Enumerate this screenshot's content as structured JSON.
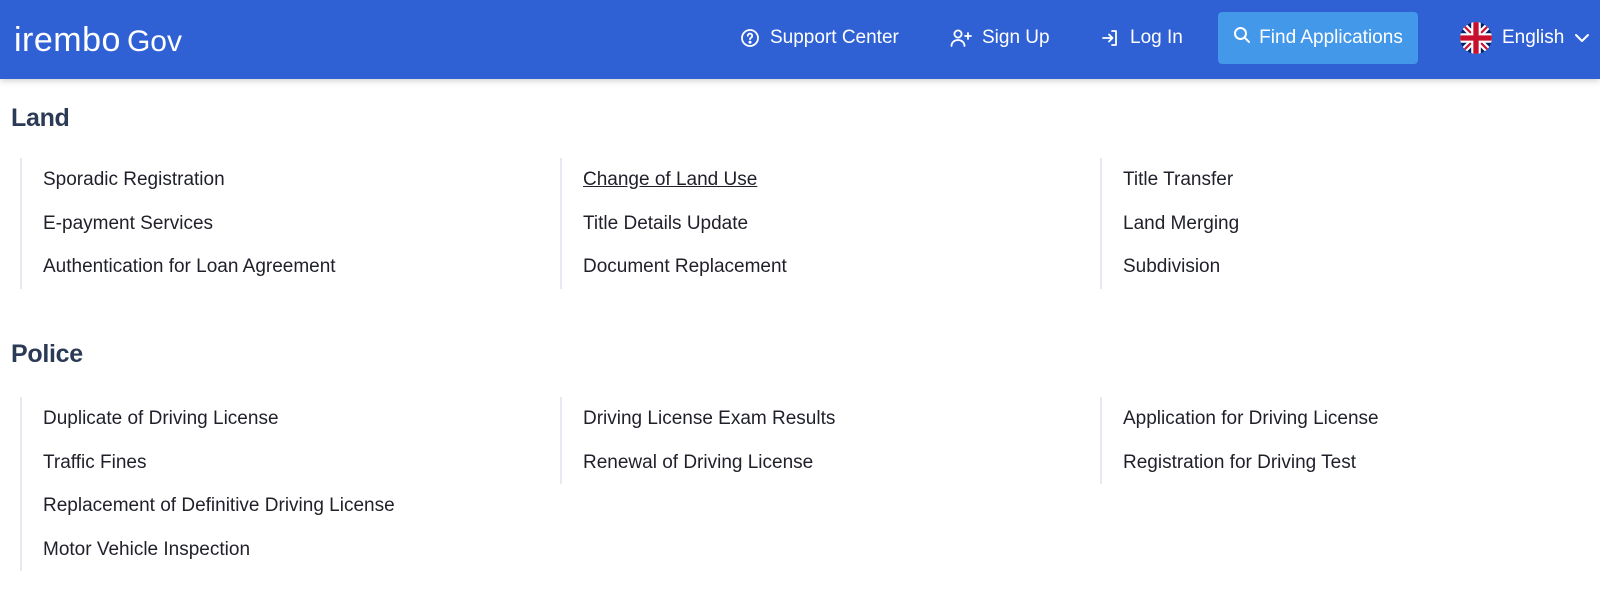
{
  "header": {
    "logo_brand": "irembo",
    "logo_suffix": "Gov",
    "support_label": "Support Center",
    "signup_label": "Sign Up",
    "login_label": "Log In",
    "find_label": "Find Applications",
    "language_label": "English",
    "icons": {
      "support": "question-circle-icon",
      "signup": "user-plus-icon",
      "login": "log-in-icon",
      "find": "search-icon",
      "language": "uk-flag-icon",
      "dropdown": "chevron-down-icon"
    },
    "colors": {
      "bar": "#2f61d5",
      "button": "#4398ea"
    }
  },
  "sections": [
    {
      "title": "Land",
      "columns": [
        [
          "Sporadic Registration",
          "E-payment Services",
          "Authentication for Loan Agreement"
        ],
        [
          "Change of Land Use",
          "Title Details Update",
          "Document Replacement"
        ],
        [
          "Title Transfer",
          "Land Merging",
          "Subdivision"
        ]
      ]
    },
    {
      "title": "Police",
      "columns": [
        [
          "Duplicate of Driving License",
          "Traffic Fines",
          "Replacement of Definitive Driving License",
          "Motor Vehicle Inspection"
        ],
        [
          "Driving License Exam Results",
          "Renewal of Driving License"
        ],
        [
          "Application for Driving License",
          "Registration for Driving Test"
        ]
      ]
    }
  ]
}
